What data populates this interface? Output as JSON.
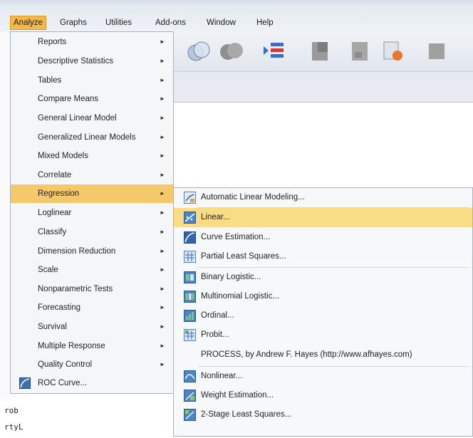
{
  "menubar": {
    "items": [
      "Analyze",
      "Graphs",
      "Utilities",
      "Add-ons",
      "Window",
      "Help"
    ]
  },
  "analyze_menu": {
    "items": [
      {
        "label": "Reports",
        "submenu": true
      },
      {
        "label": "Descriptive Statistics",
        "submenu": true
      },
      {
        "label": "Tables",
        "submenu": true
      },
      {
        "label": "Compare Means",
        "submenu": true
      },
      {
        "label": "General Linear Model",
        "submenu": true
      },
      {
        "label": "Generalized Linear Models",
        "submenu": true
      },
      {
        "label": "Mixed Models",
        "submenu": true
      },
      {
        "label": "Correlate",
        "submenu": true
      },
      {
        "label": "Regression",
        "submenu": true,
        "highlighted": true
      },
      {
        "label": "Loglinear",
        "submenu": true
      },
      {
        "label": "Classify",
        "submenu": true
      },
      {
        "label": "Dimension Reduction",
        "submenu": true
      },
      {
        "label": "Scale",
        "submenu": true
      },
      {
        "label": "Nonparametric Tests",
        "submenu": true
      },
      {
        "label": "Forecasting",
        "submenu": true
      },
      {
        "label": "Survival",
        "submenu": true
      },
      {
        "label": "Multiple Response",
        "submenu": true
      },
      {
        "label": "Quality Control",
        "submenu": true
      },
      {
        "label": "ROC Curve...",
        "submenu": false,
        "icon": "roc-curve-icon"
      }
    ],
    "arrow_glyph": "►"
  },
  "regression_submenu": {
    "items": [
      {
        "label": "Automatic Linear Modeling...",
        "icon": "automatic-linear-modeling-icon"
      },
      {
        "label": "Linear...",
        "icon": "linear-regression-icon",
        "highlighted": true
      },
      {
        "label": "Curve Estimation...",
        "icon": "curve-estimation-icon"
      },
      {
        "label": "Partial Least Squares...",
        "icon": "partial-least-squares-icon"
      },
      {
        "label": "Binary Logistic...",
        "icon": "binary-logistic-icon"
      },
      {
        "label": "Multinomial Logistic...",
        "icon": "multinomial-logistic-icon"
      },
      {
        "label": "Ordinal...",
        "icon": "ordinal-icon"
      },
      {
        "label": "Probit...",
        "icon": "probit-icon"
      },
      {
        "label": "PROCESS, by Andrew F. Hayes (http://www.afhayes.com)",
        "icon": ""
      },
      {
        "label": "Nonlinear...",
        "icon": "nonlinear-icon"
      },
      {
        "label": "Weight Estimation...",
        "icon": "weight-estimation-icon"
      },
      {
        "label": "2-Stage Least Squares...",
        "icon": "two-stage-least-squares-icon"
      }
    ]
  },
  "background_text": [
    "rob",
    "rtyL"
  ],
  "colors": {
    "menu_highlight": "#f5c86a",
    "submenu_highlight": "#fbdc86",
    "active_menubar": "#f2b84a"
  }
}
